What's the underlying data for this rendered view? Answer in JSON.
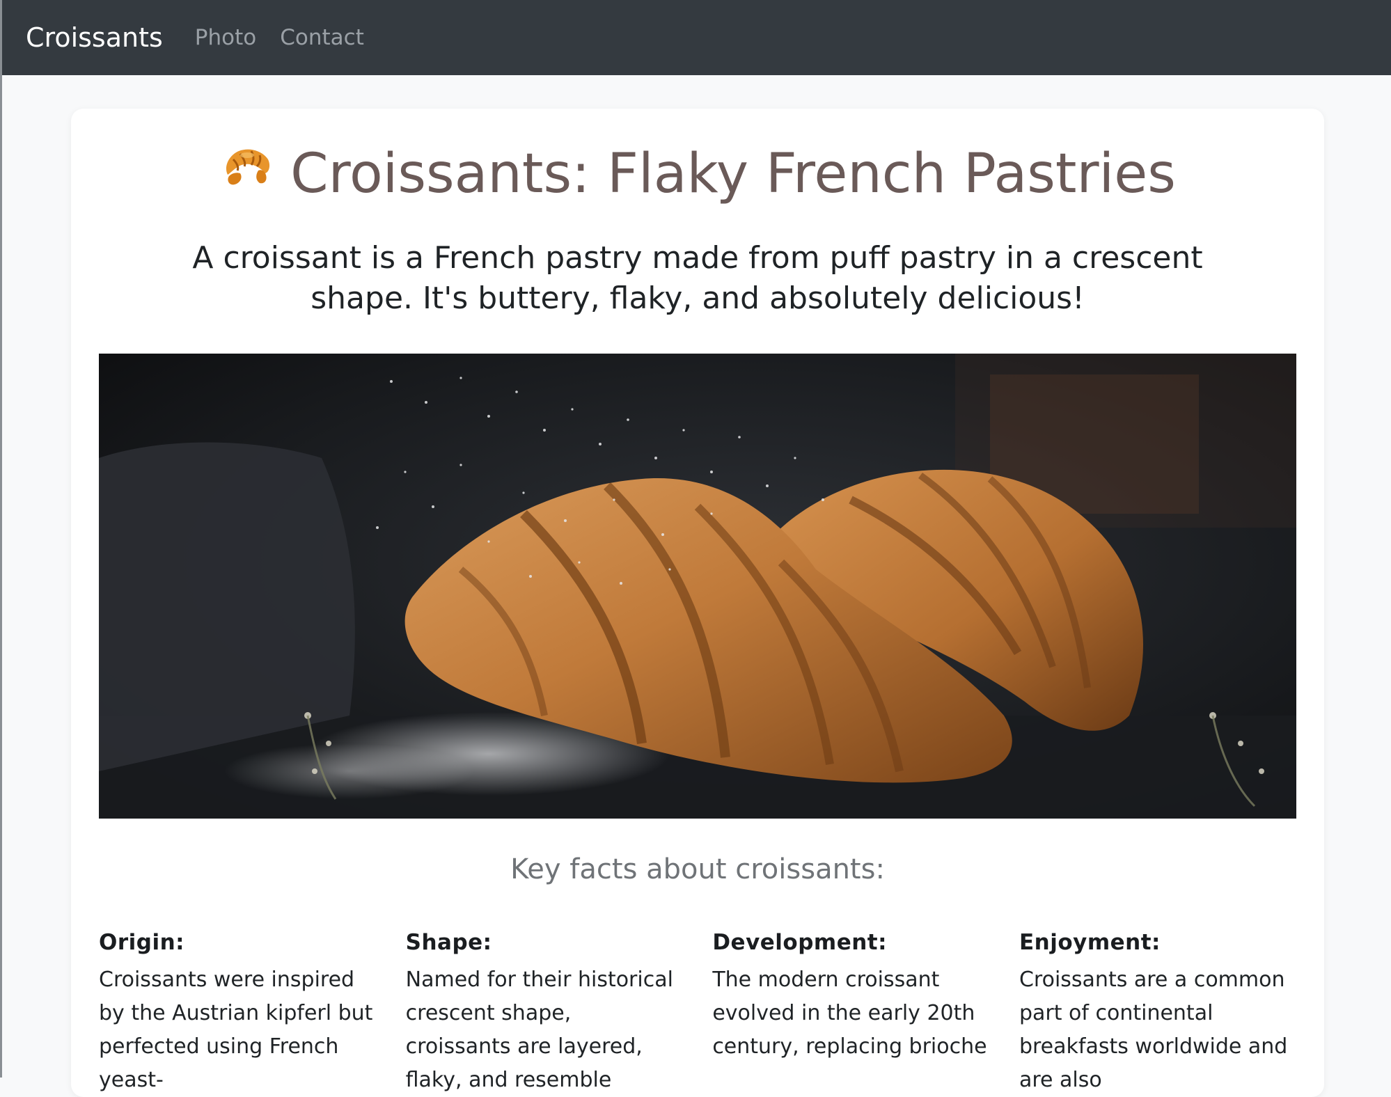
{
  "navbar": {
    "brand": "Croissants",
    "links": [
      {
        "label": "Photo"
      },
      {
        "label": "Contact"
      }
    ]
  },
  "header": {
    "icon": "croissant-icon",
    "title": "Croissants: Flaky French Pastries",
    "lead": "A croissant is a French pastry made from puff pastry in a crescent shape. It's buttery, flaky, and absolutely delicious!"
  },
  "hero": {
    "image": "croissants-photo"
  },
  "facts": {
    "heading": "Key facts about croissants:",
    "items": [
      {
        "title": "Origin:",
        "body": "Croissants were inspired by the Austrian kipferl but perfected using French yeast-"
      },
      {
        "title": "Shape:",
        "body": "Named for their historical crescent shape, croissants are layered, flaky, and resemble"
      },
      {
        "title": "Development:",
        "body": "The modern croissant evolved in the early 20th century, replacing brioche"
      },
      {
        "title": "Enjoyment:",
        "body": "Croissants are a common part of continental breakfasts worldwide and are also"
      }
    ]
  },
  "colors": {
    "navbar": "#343a40",
    "page_bg": "#f8f9fa",
    "title": "#6a5a58",
    "section_heading": "#6f7377"
  }
}
